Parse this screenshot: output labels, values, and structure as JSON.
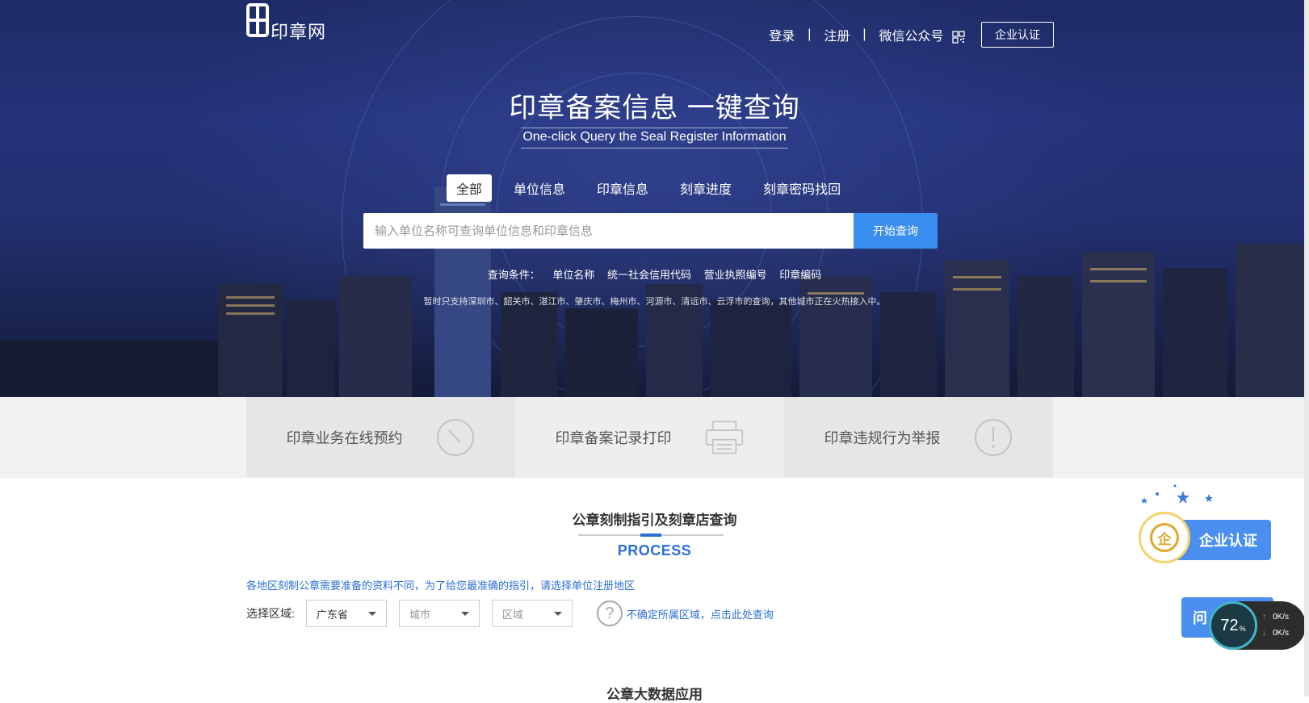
{
  "header": {
    "logo_text": "印章网",
    "nav": {
      "login": "登录",
      "sep": "|",
      "register": "注册",
      "wechat": "微信公众号",
      "cert_button": "企业认证"
    }
  },
  "hero": {
    "title": "印章备案信息 一键查询",
    "subtitle": "One-click Query the Seal Register Information",
    "tabs": [
      {
        "label": "全部",
        "active": true
      },
      {
        "label": "单位信息",
        "active": false
      },
      {
        "label": "印章信息",
        "active": false
      },
      {
        "label": "刻章进度",
        "active": false
      },
      {
        "label": "刻章密码找回",
        "active": false
      }
    ],
    "search": {
      "placeholder": "输入单位名称可查询单位信息和印章信息",
      "value": "",
      "button": "开始查询"
    },
    "conditions": {
      "label": "查询条件：",
      "items": [
        "单位名称",
        "统一社会信用代码",
        "营业执照编号",
        "印章编码"
      ]
    },
    "notice": "暂时只支持深圳市、韶关市、湛江市、肇庆市、梅州市、河源市、清远市、云浮市的查询，其他城市正在火热接入中。"
  },
  "services": [
    {
      "label": "印章业务在线预约",
      "icon": "clock-icon"
    },
    {
      "label": "印章备案记录打印",
      "icon": "printer-icon"
    },
    {
      "label": "印章违规行为举报",
      "icon": "exclamation-icon"
    }
  ],
  "process": {
    "title": "公章刻制指引及刻章店查询",
    "subtitle": "PROCESS",
    "guide": "各地区刻制公章需要准备的资料不同，为了给您最准确的指引，请选择单位注册地区",
    "region_label": "选择区域:",
    "province": "广东省",
    "city": "城市",
    "district": "区域",
    "help_text": "不确定所属区域，点击此处查询"
  },
  "next_section": {
    "title": "公章大数据应用"
  },
  "floating": {
    "cert_label": "企业认证",
    "cert_icon_char": "企",
    "ask_label": "问",
    "speed_percent": "72",
    "speed_unit": "%",
    "upload": "0K/s",
    "download": "0K/s"
  },
  "colors": {
    "accent": "#3a8ef0",
    "link": "#2b6fd6",
    "hero_bg": "#223070"
  }
}
